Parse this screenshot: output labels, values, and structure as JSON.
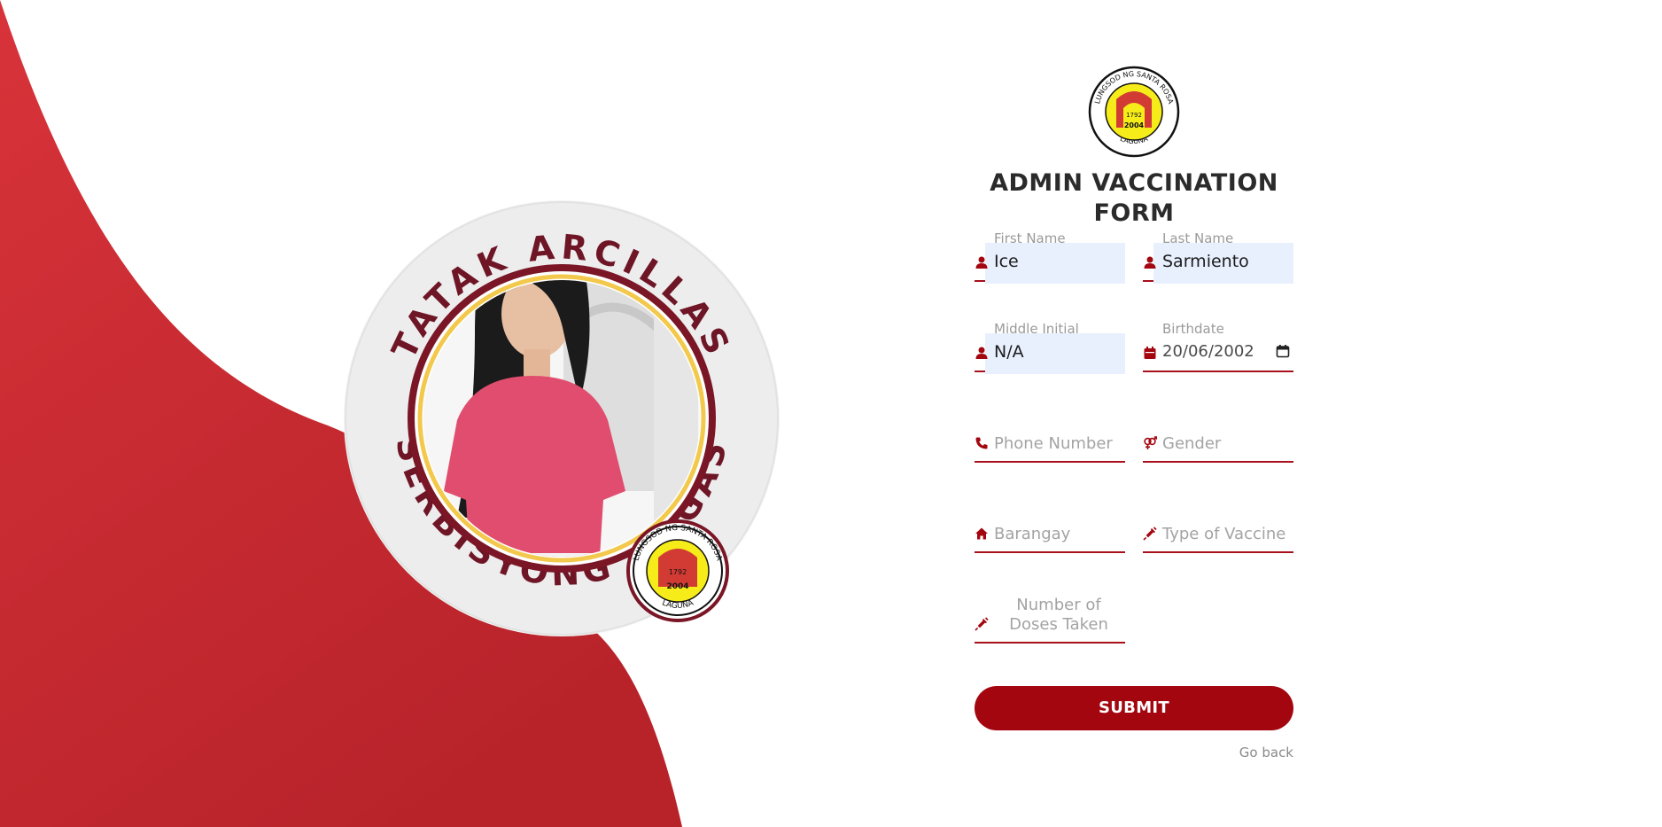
{
  "page": {
    "accent_color": "#a3060f",
    "background_wave_color": "#c8252b"
  },
  "portrait": {
    "ring_text_top": "TATAK ARCILLAS",
    "ring_text_bottom": "SERBISYONG WAGAS",
    "seal_text_top": "LUNGSOD NG SANTA ROSA",
    "seal_text_bottom": "LAGUNA",
    "seal_year_1": "1792",
    "seal_year_2": "2004"
  },
  "header": {
    "logo_icon": "santa-rosa-seal-icon",
    "title_line1": "ADMIN VACCINATION",
    "title_line2": "FORM"
  },
  "form": {
    "first_name": {
      "label": "First Name",
      "value": "Ice",
      "icon": "user-icon"
    },
    "last_name": {
      "label": "Last Name",
      "value": "Sarmiento",
      "icon": "user-icon"
    },
    "middle_initial": {
      "label": "Middle Initial",
      "value": "N/A",
      "icon": "user-icon"
    },
    "birthdate": {
      "label": "Birthdate",
      "value": "20/06/2002",
      "icon": "calendar-icon"
    },
    "phone_number": {
      "placeholder": "Phone Number",
      "icon": "phone-icon"
    },
    "gender": {
      "placeholder": "Gender",
      "icon": "gender-icon"
    },
    "barangay": {
      "placeholder": "Barangay",
      "icon": "home-icon"
    },
    "vaccine_type": {
      "placeholder": "Type of Vaccine",
      "icon": "syringe-icon"
    },
    "doses_taken": {
      "placeholder": "Number of Doses Taken",
      "icon": "syringe-icon"
    },
    "submit_label": "SUBMIT",
    "go_back_label": "Go back"
  }
}
